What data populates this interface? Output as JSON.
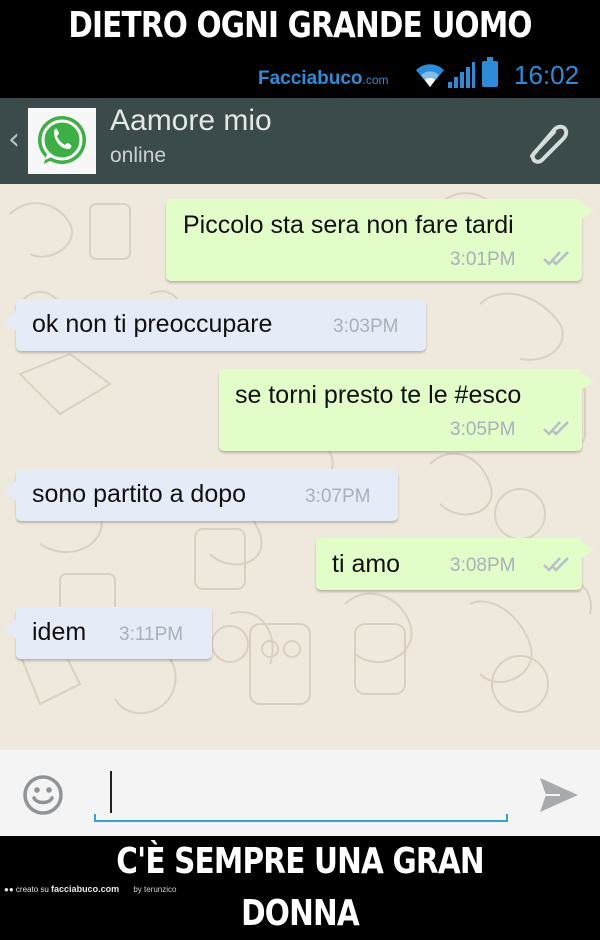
{
  "meme": {
    "top": "DIETRO OGNI GRANDE UOMO",
    "bottom": "C'È SEMPRE UNA GRAN DONNA"
  },
  "statusbar": {
    "brand": "Facciabuco",
    "brand_suffix": ".com",
    "time": "16:02",
    "accent": "#2d8cd7"
  },
  "header": {
    "back_icon": "chevron-left-icon",
    "contact_name": "Aamore mio",
    "contact_status": "online",
    "attach_icon": "paperclip-icon",
    "bg": "#3b4a4b"
  },
  "messages": [
    {
      "direction": "out",
      "text": "Piccolo sta sera non fare tardi",
      "time": "3:01PM",
      "read": true
    },
    {
      "direction": "in",
      "text": "ok non ti preoccupare",
      "time": "3:03PM"
    },
    {
      "direction": "out",
      "text": "se torni presto te le #esco",
      "time": "3:05PM",
      "read": true
    },
    {
      "direction": "in",
      "text": "sono partito a dopo",
      "time": "3:07PM"
    },
    {
      "direction": "out",
      "text": "ti amo",
      "time": "3:08PM",
      "read": true
    },
    {
      "direction": "in",
      "text": "idem",
      "time": "3:11PM"
    }
  ],
  "composer": {
    "emoji_icon": "smiley-icon",
    "value": "",
    "send_icon": "send-icon"
  },
  "footer": {
    "creato_label": "creato su",
    "site": "facciabuco.com",
    "by_label": "by terunzico"
  },
  "colors": {
    "outgoing_bubble": "#e2fdc8",
    "incoming_bubble": "#e6ecf7",
    "chat_bg": "#efe9dd",
    "input_underline": "#3aa0ce"
  }
}
